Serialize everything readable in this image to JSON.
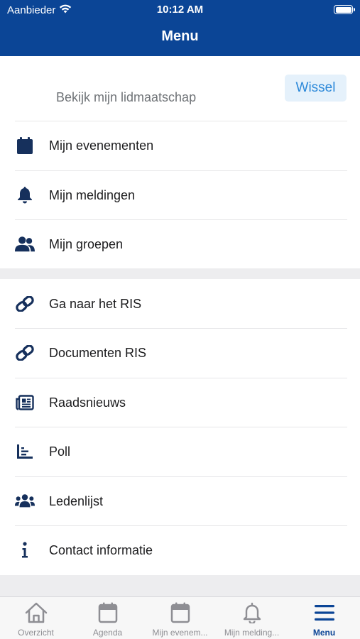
{
  "status_bar": {
    "carrier": "Aanbieder",
    "time": "10:12 AM"
  },
  "nav": {
    "title": "Menu"
  },
  "membership": {
    "text": "Bekijk mijn lidmaatschap",
    "switch_label": "Wissel"
  },
  "section1": [
    {
      "label": "Mijn evenementen",
      "icon": "calendar-icon"
    },
    {
      "label": "Mijn meldingen",
      "icon": "bell-icon"
    },
    {
      "label": "Mijn groepen",
      "icon": "users-icon"
    }
  ],
  "section2": [
    {
      "label": "Ga naar het RIS",
      "icon": "link-icon"
    },
    {
      "label": "Documenten RIS",
      "icon": "link-icon"
    },
    {
      "label": "Raadsnieuws",
      "icon": "newspaper-icon"
    },
    {
      "label": "Poll",
      "icon": "bar-chart-icon"
    },
    {
      "label": "Ledenlijst",
      "icon": "group-icon"
    },
    {
      "label": "Contact informatie",
      "icon": "info-icon"
    }
  ],
  "tabs": [
    {
      "label": "Overzicht",
      "icon": "home-icon",
      "active": false
    },
    {
      "label": "Agenda",
      "icon": "calendar-outline-icon",
      "active": false
    },
    {
      "label": "Mijn evenem...",
      "icon": "calendar-outline-icon",
      "active": false
    },
    {
      "label": "Mijn melding...",
      "icon": "bell-outline-icon",
      "active": false
    },
    {
      "label": "Menu",
      "icon": "hamburger-icon",
      "active": true
    }
  ],
  "colors": {
    "header": "#0b4596",
    "icon": "#16305c",
    "accent": "#2d89d9",
    "tab_inactive": "#8e8e93"
  }
}
